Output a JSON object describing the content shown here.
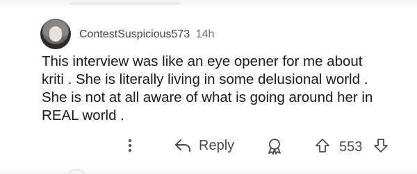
{
  "comment": {
    "username": "ContestSuspicious573",
    "time": "14h",
    "body_lines": [
      "This interview was like an eye opener for me about",
      "kriti . She is literally living in some delusional world .",
      "She is not at all aware of what is going around her in",
      "REAL world ."
    ],
    "actions": {
      "reply_label": "Reply",
      "score": "553"
    }
  },
  "icons": {
    "more": "more-vertical-icon",
    "reply": "reply-arrow-icon",
    "award": "award-icon",
    "upvote": "upvote-arrow-icon",
    "downvote": "downvote-arrow-icon"
  },
  "colors": {
    "text": "#1a1a1a",
    "meta": "#444444",
    "icon": "#4a4a4a"
  }
}
